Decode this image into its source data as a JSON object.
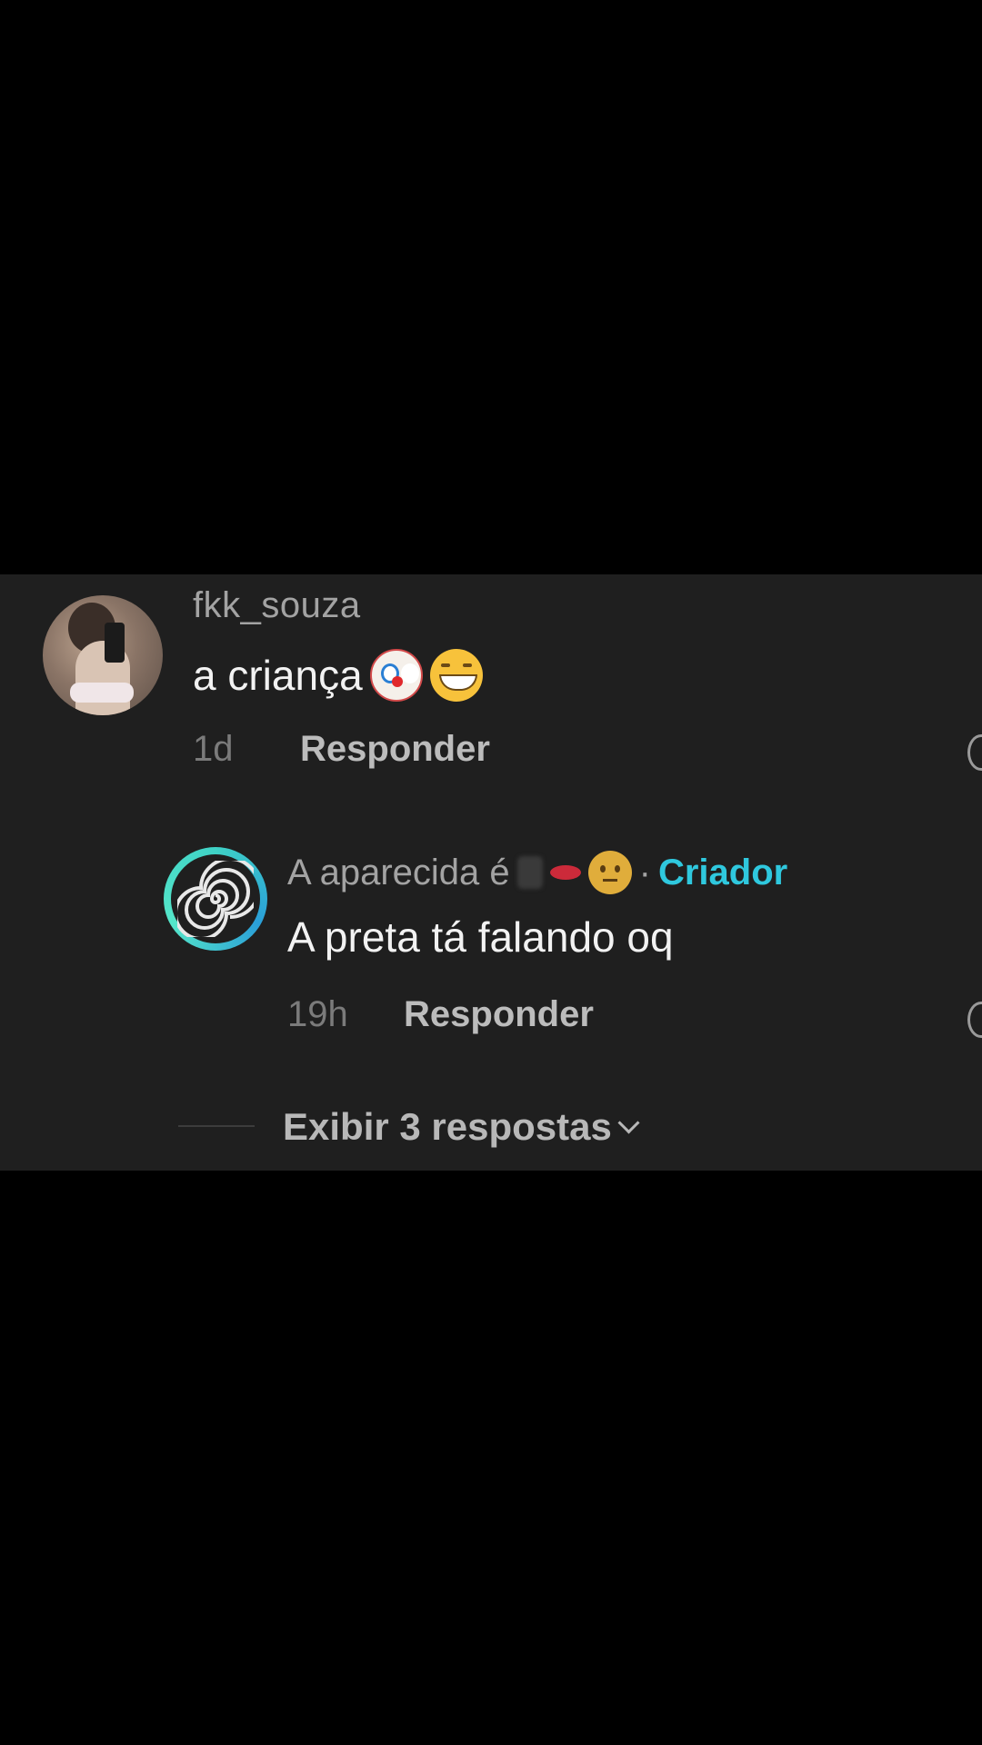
{
  "comment": {
    "username": "fkk_souza",
    "text": "a criança",
    "emojis": [
      "clown-emoji",
      "grinning-emoji"
    ],
    "time": "1d",
    "reply_label": "Responder"
  },
  "reply_comment": {
    "username": "A aparecida é",
    "separator": "·",
    "creator_badge": "Criador",
    "text": "A preta tá falando oq",
    "time": "19h",
    "reply_label": "Responder"
  },
  "view_replies": {
    "label": "Exibir 3 respostas"
  },
  "colors": {
    "background": "#000000",
    "panel": "#1f1f1f",
    "creator_accent": "#2fc8de"
  }
}
